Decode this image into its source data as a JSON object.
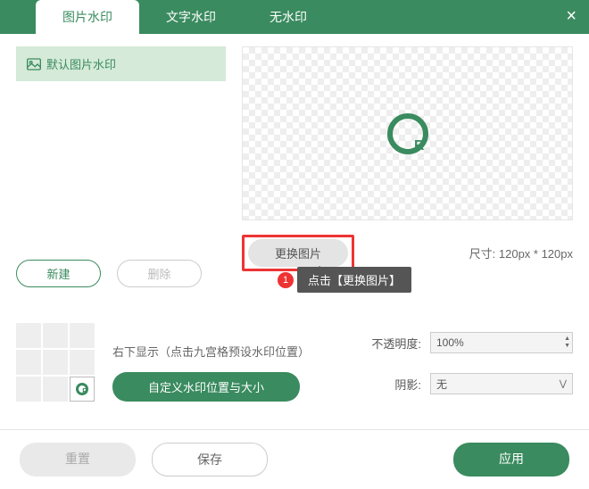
{
  "tabs": {
    "image": "图片水印",
    "text": "文字水印",
    "none": "无水印"
  },
  "list": {
    "default_item": "默认图片水印"
  },
  "buttons": {
    "new": "新建",
    "delete": "删除",
    "change_image": "更换图片",
    "custom_pos": "自定义水印位置与大小",
    "reset": "重置",
    "save": "保存",
    "apply": "应用"
  },
  "labels": {
    "size_prefix": "尺寸:",
    "size_value": "120px * 120px",
    "grid_hint": "右下显示（点击九宫格预设水印位置）",
    "opacity": "不透明度:",
    "shadow": "阴影:"
  },
  "values": {
    "opacity": "100%",
    "shadow": "无"
  },
  "tooltip": {
    "num": "1",
    "text": "点击【更换图片】"
  }
}
